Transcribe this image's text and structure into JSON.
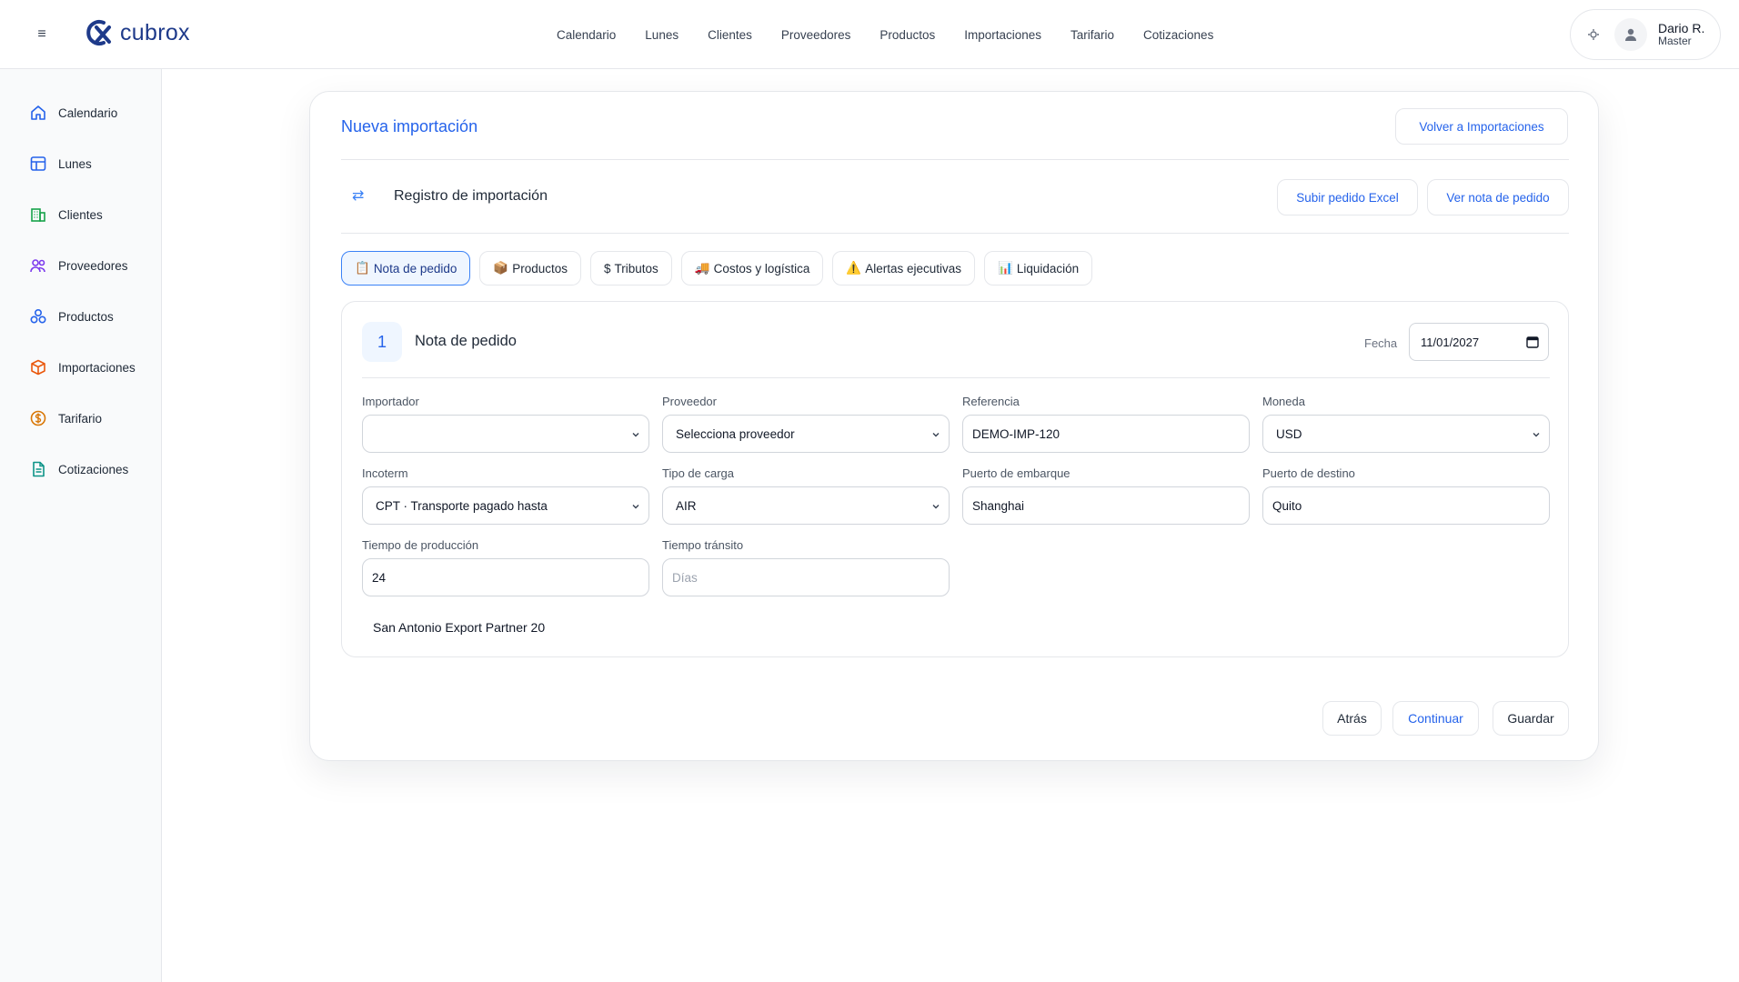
{
  "app": {
    "brand": "cubrox"
  },
  "topnav": [
    "Calendario",
    "Lunes",
    "Clientes",
    "Proveedores",
    "Productos",
    "Importaciones",
    "Tarifario",
    "Cotizaciones"
  ],
  "user": {
    "name": "Dario R.",
    "role": "Master"
  },
  "sidebar": {
    "items": [
      {
        "label": "Calendario",
        "icon": "home-icon",
        "color": "#2563eb"
      },
      {
        "label": "Lunes",
        "icon": "table-icon",
        "color": "#2563eb"
      },
      {
        "label": "Clientes",
        "icon": "building-icon",
        "color": "#16a34a"
      },
      {
        "label": "Proveedores",
        "icon": "supplier-icon",
        "color": "#7c3aed"
      },
      {
        "label": "Productos",
        "icon": "products-icon",
        "color": "#2563eb"
      },
      {
        "label": "Importaciones",
        "icon": "box-icon",
        "color": "#ea580c"
      },
      {
        "label": "Tarifario",
        "icon": "dollar-icon",
        "color": "#d97706"
      },
      {
        "label": "Cotizaciones",
        "icon": "document-icon",
        "color": "#0d9488"
      }
    ]
  },
  "card": {
    "title": "Nueva importación",
    "back_button": "Volver a Importaciones",
    "section_title": "Registro de importación",
    "upload_button": "Subir pedido Excel",
    "view_note_button": "Ver nota de pedido"
  },
  "tabs": [
    {
      "emoji": "📋",
      "label": "Nota de pedido"
    },
    {
      "emoji": "📦",
      "label": "Productos"
    },
    {
      "emoji": "$",
      "label": "Tributos"
    },
    {
      "emoji": "🚚",
      "label": "Costos y logística"
    },
    {
      "emoji": "⚠️",
      "label": "Alertas ejecutivas"
    },
    {
      "emoji": "📊",
      "label": "Liquidación"
    }
  ],
  "form": {
    "step_number": "1",
    "step_title": "Nota de pedido",
    "fecha_label": "Fecha",
    "fecha_value": "11/01/2027",
    "importador_label": "Importador",
    "importador_value": "",
    "proveedor_label": "Proveedor",
    "proveedor_value": "Selecciona proveedor",
    "referencia_label": "Referencia",
    "referencia_value": "DEMO-IMP-120",
    "moneda_label": "Moneda",
    "moneda_value": "USD",
    "incoterm_label": "Incoterm",
    "incoterm_value": "CPT · Transporte pagado hasta",
    "tipo_carga_label": "Tipo de carga",
    "tipo_carga_value": "AIR",
    "puerto_embarque_label": "Puerto de embarque",
    "puerto_embarque_value": "Shanghai",
    "puerto_destino_label": "Puerto de destino",
    "puerto_destino_value": "Quito",
    "tiempo_produccion_label": "Tiempo de producción",
    "tiempo_produccion_value": "24",
    "tiempo_transito_label": "Tiempo tránsito",
    "tiempo_transito_placeholder": "Días",
    "supplier_note": "San Antonio Export Partner 20"
  },
  "footer": {
    "back": "Atrás",
    "continue": "Continuar",
    "save": "Guardar"
  }
}
